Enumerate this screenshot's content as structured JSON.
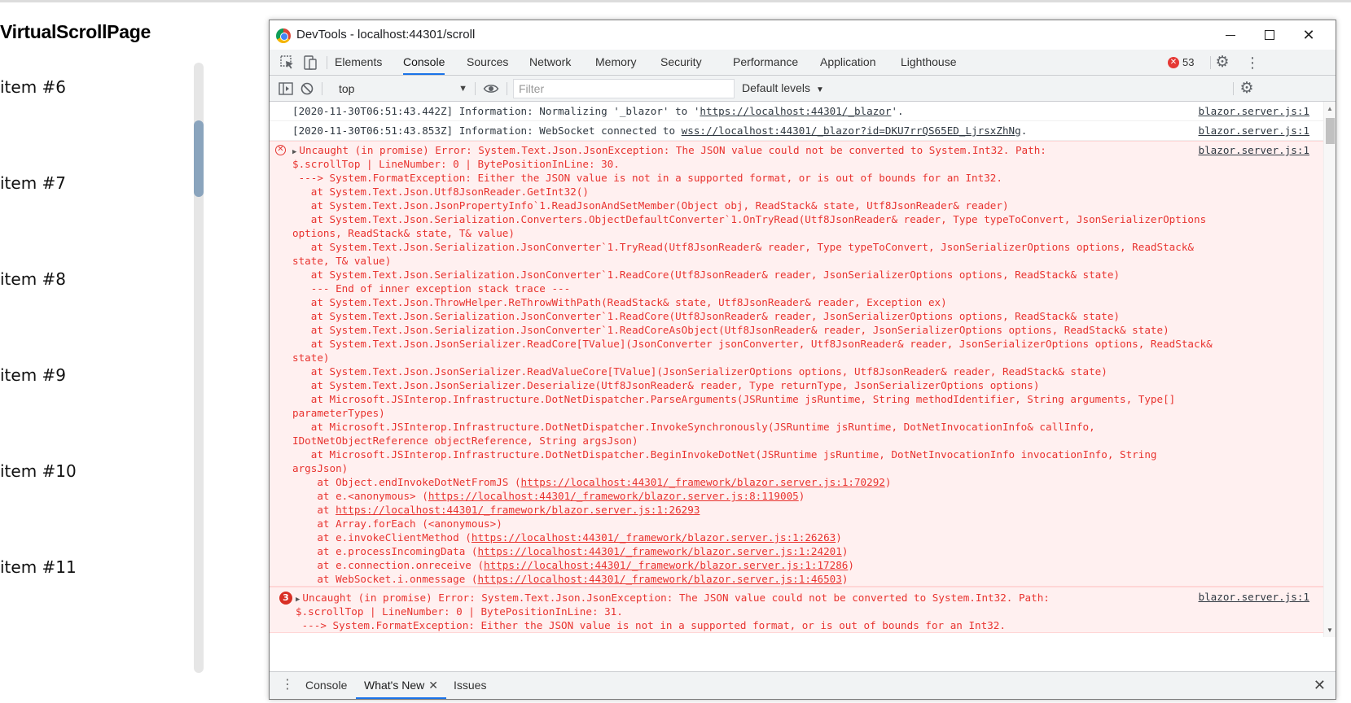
{
  "page": {
    "title": "VirtualScrollPage",
    "items": [
      "item #6",
      "item #7",
      "item #8",
      "item #9",
      "item #10",
      "item #11"
    ]
  },
  "window": {
    "title": "DevTools - localhost:44301/scroll"
  },
  "tabs": [
    "Elements",
    "Console",
    "Sources",
    "Network",
    "Memory",
    "Security",
    "Performance",
    "Application",
    "Lighthouse"
  ],
  "active_tab": "Console",
  "error_count": "53",
  "toolbar": {
    "context": "top",
    "filter_placeholder": "Filter",
    "levels": "Default levels"
  },
  "log": {
    "info1": "[2020-11-30T06:51:43.442Z] Information: Normalizing '_blazor' to 'https://localhost:44301/_blazor'.",
    "info1_prefix": "[2020-11-30T06:51:43.442Z] Information: Normalizing '_blazor' to '",
    "info1_link": "https://localhost:44301/_blazor",
    "info1_suffix": "'.",
    "info2_prefix": "[2020-11-30T06:51:43.853Z] Information: WebSocket connected to ",
    "info2_link": "wss://localhost:44301/_blazor?id=DKU7rrQS65ED_LjrsxZhNg",
    "info2_suffix": ".",
    "source": "blazor.server.js:1",
    "error1_lines": [
      "Uncaught (in promise) Error: System.Text.Json.JsonException: The JSON value could not be converted to System.Int32. Path:",
      "$.scrollTop | LineNumber: 0 | BytePositionInLine: 30.",
      " ---> System.FormatException: Either the JSON value is not in a supported format, or is out of bounds for an Int32.",
      "   at System.Text.Json.Utf8JsonReader.GetInt32()",
      "   at System.Text.Json.JsonPropertyInfo`1.ReadJsonAndSetMember(Object obj, ReadStack& state, Utf8JsonReader& reader)",
      "   at System.Text.Json.Serialization.Converters.ObjectDefaultConverter`1.OnTryRead(Utf8JsonReader& reader, Type typeToConvert, JsonSerializerOptions",
      "options, ReadStack& state, T& value)",
      "   at System.Text.Json.Serialization.JsonConverter`1.TryRead(Utf8JsonReader& reader, Type typeToConvert, JsonSerializerOptions options, ReadStack&",
      "state, T& value)",
      "   at System.Text.Json.Serialization.JsonConverter`1.ReadCore(Utf8JsonReader& reader, JsonSerializerOptions options, ReadStack& state)",
      "   --- End of inner exception stack trace ---",
      "   at System.Text.Json.ThrowHelper.ReThrowWithPath(ReadStack& state, Utf8JsonReader& reader, Exception ex)",
      "   at System.Text.Json.Serialization.JsonConverter`1.ReadCore(Utf8JsonReader& reader, JsonSerializerOptions options, ReadStack& state)",
      "   at System.Text.Json.Serialization.JsonConverter`1.ReadCoreAsObject(Utf8JsonReader& reader, JsonSerializerOptions options, ReadStack& state)",
      "   at System.Text.Json.JsonSerializer.ReadCore[TValue](JsonConverter jsonConverter, Utf8JsonReader& reader, JsonSerializerOptions options, ReadStack&",
      "state)",
      "   at System.Text.Json.JsonSerializer.ReadValueCore[TValue](JsonSerializerOptions options, Utf8JsonReader& reader, ReadStack& state)",
      "   at System.Text.Json.JsonSerializer.Deserialize(Utf8JsonReader& reader, Type returnType, JsonSerializerOptions options)",
      "   at Microsoft.JSInterop.Infrastructure.DotNetDispatcher.ParseArguments(JSRuntime jsRuntime, String methodIdentifier, String arguments, Type[]",
      "parameterTypes)",
      "   at Microsoft.JSInterop.Infrastructure.DotNetDispatcher.InvokeSynchronously(JSRuntime jsRuntime, DotNetInvocationInfo& callInfo,",
      "IDotNetObjectReference objectReference, String argsJson)",
      "   at Microsoft.JSInterop.Infrastructure.DotNetDispatcher.BeginInvokeDotNet(JSRuntime jsRuntime, DotNetInvocationInfo invocationInfo, String",
      "argsJson)"
    ],
    "stack": [
      {
        "prefix": "    at Object.endInvokeDotNetFromJS (",
        "link": "https://localhost:44301/_framework/blazor.server.js:1:70292",
        "suffix": ")"
      },
      {
        "prefix": "    at e.<anonymous> (",
        "link": "https://localhost:44301/_framework/blazor.server.js:8:119005",
        "suffix": ")"
      },
      {
        "prefix": "    at ",
        "link": "https://localhost:44301/_framework/blazor.server.js:1:26293",
        "suffix": ""
      },
      {
        "prefix": "    at Array.forEach (<anonymous>)",
        "link": "",
        "suffix": ""
      },
      {
        "prefix": "    at e.invokeClientMethod (",
        "link": "https://localhost:44301/_framework/blazor.server.js:1:26263",
        "suffix": ")"
      },
      {
        "prefix": "    at e.processIncomingData (",
        "link": "https://localhost:44301/_framework/blazor.server.js:1:24201",
        "suffix": ")"
      },
      {
        "prefix": "    at e.connection.onreceive (",
        "link": "https://localhost:44301/_framework/blazor.server.js:1:17286",
        "suffix": ")"
      },
      {
        "prefix": "    at WebSocket.i.onmessage (",
        "link": "https://localhost:44301/_framework/blazor.server.js:1:46503",
        "suffix": ")"
      }
    ],
    "error2_count": "3",
    "error2_lines": [
      "Uncaught (in promise) Error: System.Text.Json.JsonException: The JSON value could not be converted to System.Int32. Path:",
      "$.scrollTop | LineNumber: 0 | BytePositionInLine: 31.",
      " ---> System.FormatException: Either the JSON value is not in a supported format, or is out of bounds for an Int32."
    ]
  },
  "drawer": {
    "tabs": [
      "Console",
      "What's New",
      "Issues"
    ],
    "active": "What's New"
  },
  "colors": {
    "error_text": "#e8332f",
    "error_bg": "#fff0f0",
    "accent": "#1a73e8",
    "scroll_thumb": "#8aa4bd"
  }
}
